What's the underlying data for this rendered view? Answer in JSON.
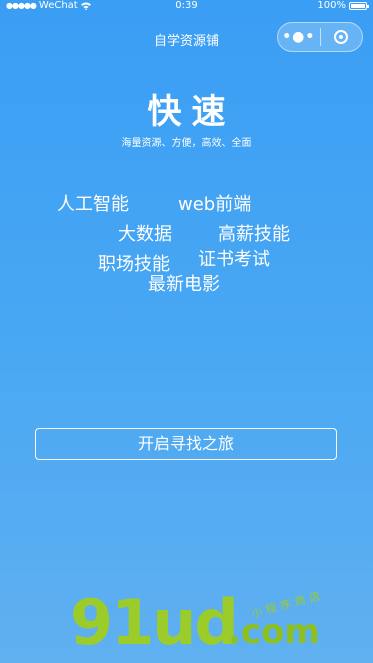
{
  "status_bar": {
    "carrier": "WeChat",
    "time": "0:39",
    "battery_text": "100%",
    "signal_dots": "●●●●●",
    "wifi_icon": "wifi-icon"
  },
  "nav": {
    "title": "自学资源铺",
    "more_glyph": "•●•"
  },
  "hero": {
    "title": "快速",
    "subtitle": "海量资源、方便，高效、全面"
  },
  "tags": [
    "人工智能",
    "web前端",
    "大数据",
    "高薪技能",
    "证书考试",
    "职场技能",
    "最新电影"
  ],
  "start_button": {
    "label": "开启寻找之旅"
  },
  "watermark": {
    "digits": "91ud",
    "domain": ".com",
    "small_text": "小程序商店"
  },
  "colors": {
    "background_top": "#3a9ef4",
    "background_bottom": "#60b0f0",
    "text": "#ffffff",
    "watermark_green": "#9bcc2a"
  }
}
